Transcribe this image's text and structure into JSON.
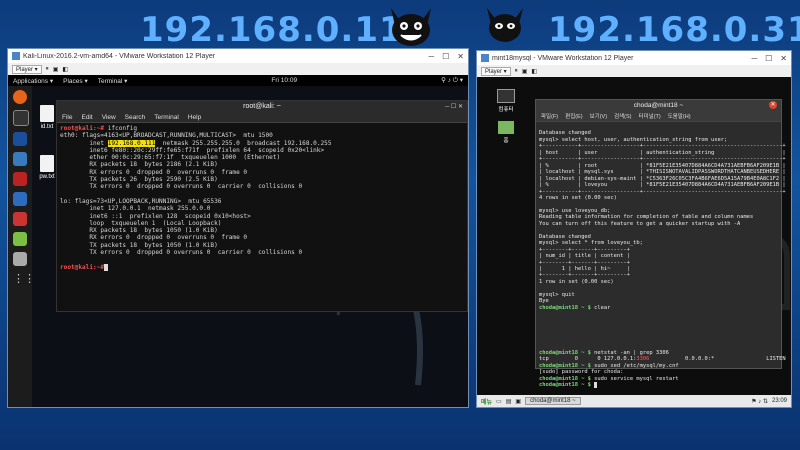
{
  "header": {
    "left_ip": "192.168.0.111",
    "right_ip": "192.168.0.31"
  },
  "left_vm": {
    "window_title": "Kali-Linux-2016.2-vm-amd64 - VMware Workstation 12 Player",
    "player_label": "Player ▾",
    "topbar": {
      "applications": "Applications ▾",
      "places": "Places ▾",
      "terminal": "Terminal ▾",
      "clock": "Fri 10:09"
    },
    "desktop_files": [
      "id.txt",
      "pw.txt"
    ],
    "terminal": {
      "title": "root@kali: ~",
      "menu": [
        "File",
        "Edit",
        "View",
        "Search",
        "Terminal",
        "Help"
      ],
      "prompt": "root@kali:~#",
      "command": " ifconfig",
      "lines_before_hl": [
        "eth0: flags=4163<UP,BROADCAST,RUNNING,MULTICAST>  mtu 1500"
      ],
      "hl_prefix": "        inet ",
      "hl_text": "192.168.0.111",
      "hl_suffix": "  netmask 255.255.255.0  broadcast 192.168.0.255",
      "lines_after_hl": [
        "        inet6 fe80::20c:29ff:fe65:f71f  prefixlen 64  scopeid 0x20<link>",
        "        ether 00:0c:29:65:f7:1f  txqueuelen 1000  (Ethernet)",
        "        RX packets 18  bytes 2186 (2.1 KiB)",
        "        RX errors 0  dropped 0  overruns 0  frame 0",
        "        TX packets 26  bytes 2590 (2.5 KiB)",
        "        TX errors 0  dropped 0 overruns 0  carrier 0  collisions 0",
        "",
        "lo: flags=73<UP,LOOPBACK,RUNNING>  mtu 65536",
        "        inet 127.0.0.1  netmask 255.0.0.0",
        "        inet6 ::1  prefixlen 128  scopeid 0x10<host>",
        "        loop  txqueuelen 1  (Local Loopback)",
        "        RX packets 18  bytes 1050 (1.0 KiB)",
        "        RX errors 0  dropped 0  overruns 0  frame 0",
        "        TX packets 18  bytes 1050 (1.0 KiB)",
        "        TX errors 0  dropped 0 overruns 0  carrier 0  collisions 0",
        ""
      ],
      "final_prompt": "root@kali:~#"
    }
  },
  "right_vm": {
    "window_title": "mint18mysql - VMware Workstation 12 Player",
    "player_label": "Player ▾",
    "desktop_labels": [
      "컴퓨터",
      "홈"
    ],
    "terminal": {
      "title": "choda@mint18 ~",
      "menu": [
        "파일(F)",
        "편집(E)",
        "보기(V)",
        "검색(S)",
        "터미널(T)",
        "도움말(H)"
      ],
      "lines": [
        "",
        "Database changed",
        "mysql> select host, user, authentication_string from user;",
        "+-----------+------------------+-------------------------------------------+",
        "| host      | user             | authentication_string                     |",
        "+-----------+------------------+-------------------------------------------+",
        "| %         | root             | *81F5E21E35407D884A6CD4A731AEBFB6AF209E1B |",
        "| localhost | mysql.sys        | *THISISNOTAVALIDPASSWORDTHATCANBEUSEDHERE |",
        "| localhost | debian-sys-maint | *C5363F26C05C3FA4B6FAE6D5A15A79B4E0A8C1F2 |",
        "| %         | loveyou          | *81F5E21E35407D884A6CD4A731AEBFB6AF209E1B |",
        "+-----------+------------------+-------------------------------------------+",
        "4 rows in set (0.00 sec)",
        "",
        "mysql> use loveyou_db;",
        "Reading table information for completion of table and column names",
        "You can turn off this feature to get a quicker startup with -A",
        "",
        "Database changed",
        "mysql> select * from loveyou_tb;",
        "+--------+-------+---------+",
        "| num_id | title | content |",
        "+--------+-------+---------+",
        "|      1 | hello | hi~     |",
        "+--------+-------+---------+",
        "1 row in set (0.00 sec)",
        "",
        "mysql> quit",
        "Bye"
      ],
      "prompt": "choda@mint18 ~ $",
      "cmd_clear": " clear",
      "cmd_netstat": " netstat -an | grep 3306",
      "netstat_line_a": "tcp        0      0 127.0.0.1:",
      "netstat_port": "3306",
      "netstat_line_b": "           0.0.0.0:*                LISTEN",
      "cmd_xed": " sudo xed /etc/mysql/my.cnf",
      "sudo_line": "[sudo] password for choda:",
      "cmd_restart": " sudo service mysql restart"
    },
    "taskbar": {
      "menu": "메뉴",
      "task": "choda@mint18 ~",
      "clock": "23:09"
    }
  }
}
